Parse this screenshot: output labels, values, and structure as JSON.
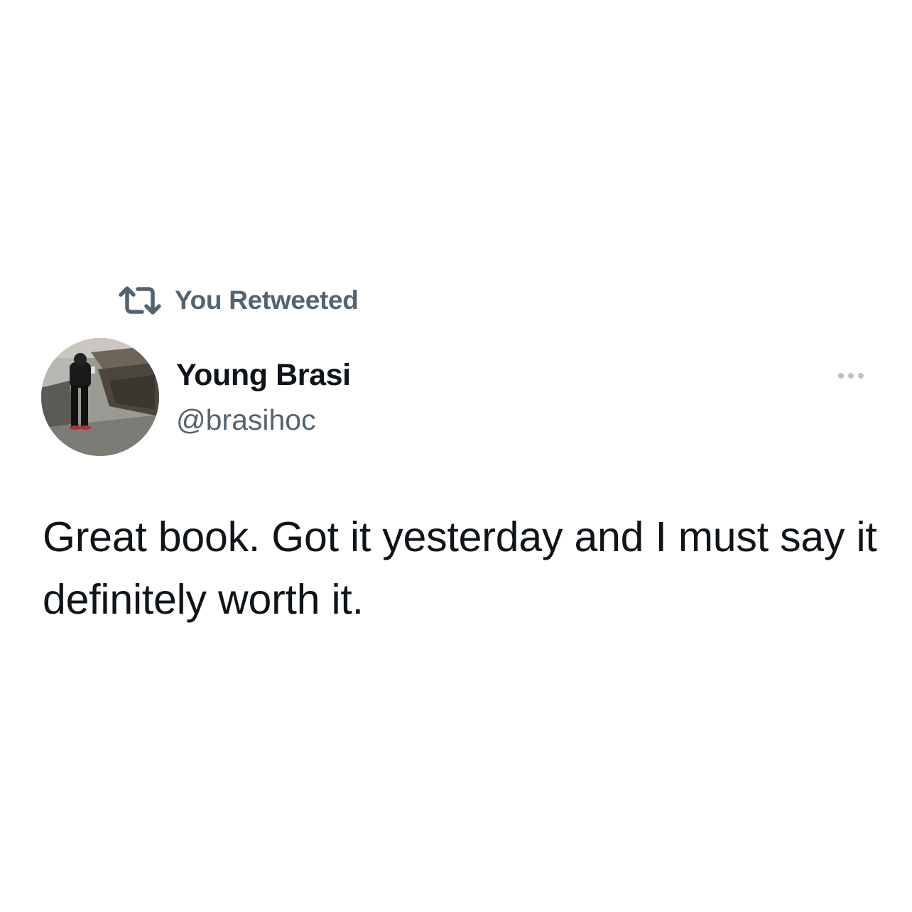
{
  "retweet_context": {
    "icon": "retweet-icon",
    "label": "You Retweeted"
  },
  "author": {
    "display_name": "Young Brasi",
    "handle": "@brasihoc",
    "avatar": "profile-photo"
  },
  "more_menu": {
    "icon": "more-options-icon"
  },
  "tweet": {
    "text": "Great book. Got it yesterday and I must say it definitely worth it."
  },
  "colors": {
    "primary_text": "#0f1419",
    "secondary_text": "#536471",
    "background": "#ffffff"
  }
}
